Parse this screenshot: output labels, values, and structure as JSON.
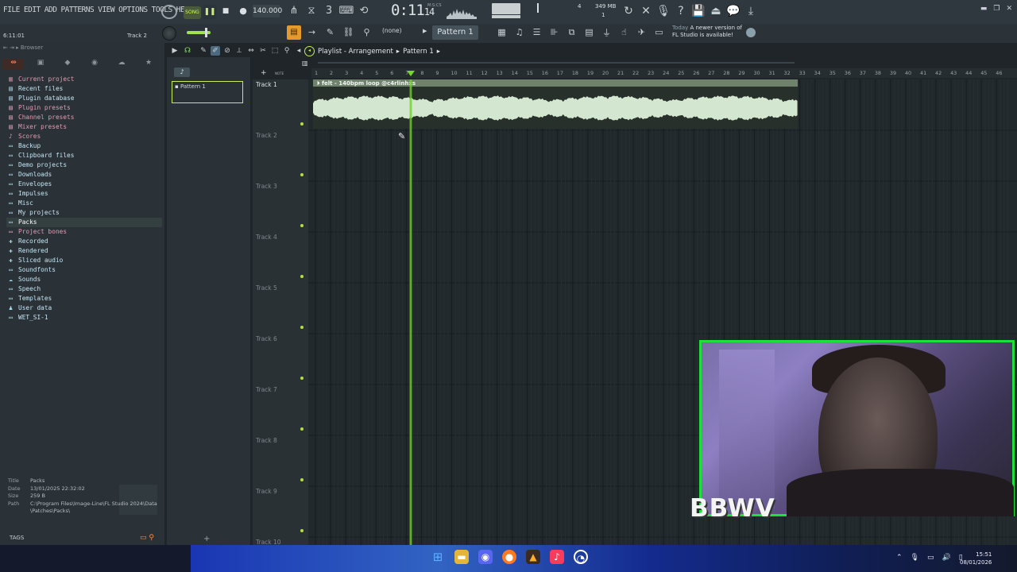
{
  "menu": [
    "FILE",
    "EDIT",
    "ADD",
    "PATTERNS",
    "VIEW",
    "OPTIONS",
    "TOOLS",
    "HELP"
  ],
  "transport": {
    "mode": "SONG",
    "tempo": "140.000",
    "time_main": "0:11",
    "time_sub": "14",
    "time_label": "M:S:CS"
  },
  "status": {
    "cpu": "4",
    "memory": "349 MB",
    "polyphony": "1"
  },
  "hint_bar": {
    "position": "6:11:01",
    "track": "Track 2"
  },
  "snap": "(none)",
  "pattern_select": "Pattern 1",
  "news": {
    "date": "Today",
    "text": "A newer version of FL Studio is available!"
  },
  "browser": {
    "title": "Browser",
    "items": [
      {
        "label": "Current project",
        "icon": "project-icon",
        "color": "pink"
      },
      {
        "label": "Recent files",
        "icon": "recent-icon",
        "color": "cyan"
      },
      {
        "label": "Plugin database",
        "icon": "plugin-db-icon",
        "color": "cyan"
      },
      {
        "label": "Plugin presets",
        "icon": "plugin-presets-icon",
        "color": "pink"
      },
      {
        "label": "Channel presets",
        "icon": "channel-presets-icon",
        "color": "pink"
      },
      {
        "label": "Mixer presets",
        "icon": "mixer-presets-icon",
        "color": "pink"
      },
      {
        "label": "Scores",
        "icon": "scores-icon",
        "color": "pink"
      },
      {
        "label": "Backup",
        "icon": "folder-icon",
        "color": "cyan"
      },
      {
        "label": "Clipboard files",
        "icon": "folder-icon",
        "color": "cyan"
      },
      {
        "label": "Demo projects",
        "icon": "folder-icon",
        "color": "cyan"
      },
      {
        "label": "Downloads",
        "icon": "folder-icon",
        "color": "cyan"
      },
      {
        "label": "Envelopes",
        "icon": "folder-icon",
        "color": "cyan"
      },
      {
        "label": "Impulses",
        "icon": "folder-icon",
        "color": "cyan"
      },
      {
        "label": "Misc",
        "icon": "folder-icon",
        "color": "cyan"
      },
      {
        "label": "My projects",
        "icon": "folder-icon",
        "color": "cyan"
      },
      {
        "label": "Packs",
        "icon": "folder-icon",
        "color": "cyan"
      },
      {
        "label": "Project bones",
        "icon": "folder-icon",
        "color": "pink"
      },
      {
        "label": "Recorded",
        "icon": "recorded-icon",
        "color": "cyan"
      },
      {
        "label": "Rendered",
        "icon": "rendered-icon",
        "color": "cyan"
      },
      {
        "label": "Sliced audio",
        "icon": "sliced-icon",
        "color": "cyan"
      },
      {
        "label": "Soundfonts",
        "icon": "folder-icon",
        "color": "cyan"
      },
      {
        "label": "Sounds",
        "icon": "cloud-icon",
        "color": "cyan"
      },
      {
        "label": "Speech",
        "icon": "folder-icon",
        "color": "cyan"
      },
      {
        "label": "Templates",
        "icon": "folder-icon",
        "color": "cyan"
      },
      {
        "label": "User data",
        "icon": "user-icon",
        "color": "cyan"
      },
      {
        "label": "WET_SI-1",
        "icon": "folder-icon",
        "color": "cyan"
      }
    ],
    "selected_index": 15,
    "info": {
      "title_label": "Title",
      "title_value": "Packs",
      "date_label": "Date",
      "date_value": "13/01/2025 22:32:02",
      "size_label": "Size",
      "size_value": "259 B",
      "path_label": "Path",
      "path_value": "C:\\Program Files\\Image-Line\\FL Studio 2024\\Data\\Patches\\Packs\\"
    },
    "tags_label": "TAGS"
  },
  "picker": {
    "pattern": "Pattern 1"
  },
  "playlist": {
    "title": "Playlist - Arrangement",
    "pattern": "Pattern 1",
    "tracks": [
      "Track 1",
      "Track 2",
      "Track 3",
      "Track 4",
      "Track 5",
      "Track 6",
      "Track 7",
      "Track 8",
      "Track 9",
      "Track 10"
    ],
    "ruler": [
      "1",
      "2",
      "3",
      "4",
      "5",
      "6",
      "7",
      "8",
      "9",
      "10",
      "11",
      "12",
      "13",
      "14",
      "15",
      "16",
      "17",
      "18",
      "19",
      "20",
      "21",
      "22",
      "23",
      "24",
      "25",
      "26",
      "27",
      "28",
      "29",
      "30",
      "31",
      "32",
      "33",
      "34",
      "35",
      "36",
      "37",
      "38",
      "39",
      "40",
      "41",
      "42",
      "43",
      "44",
      "45",
      "46"
    ],
    "clip": {
      "title": "felt - 140bpm loop @c4rlinhxs",
      "bars": 32
    },
    "playhead_bar": 7.3
  },
  "webcam": {
    "label": "BBWV"
  },
  "clock": {
    "time": "15:51",
    "date": "08/01/2026"
  }
}
